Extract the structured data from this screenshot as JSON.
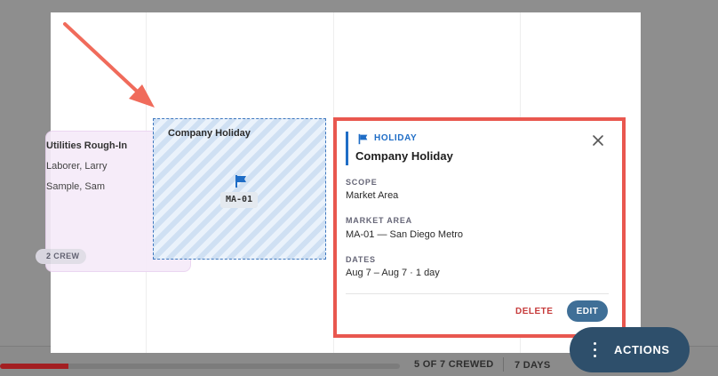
{
  "background": {
    "progress_fraction": 0.17,
    "crewed_status": "5 OF 7 CREWED",
    "days": "7 DAYS"
  },
  "activity_card": {
    "title": "Utilities Rough-In",
    "assignees": [
      "Laborer, Larry",
      "Sample, Sam"
    ],
    "crew_badge": "2 CREW"
  },
  "holiday_tile": {
    "title": "Company Holiday",
    "code": "MA-01",
    "icon": "flag-icon"
  },
  "popover": {
    "kind": "HOLIDAY",
    "title": "Company Holiday",
    "fields": [
      {
        "label": "SCOPE",
        "value": "Market Area"
      },
      {
        "label": "MARKET AREA",
        "value": "MA-01 — San Diego Metro"
      },
      {
        "label": "DATES",
        "value": "Aug 7 – Aug 7 · 1 day"
      }
    ],
    "delete_label": "DELETE",
    "edit_label": "EDIT"
  },
  "actions": {
    "label": "ACTIONS"
  },
  "colors": {
    "accent": "#1f6dc6",
    "highlight": "#e9574f",
    "delete": "#c63b3b",
    "edit_button": "#3f6f97",
    "fab": "#2e4f6b",
    "progress": "#a31f22"
  }
}
